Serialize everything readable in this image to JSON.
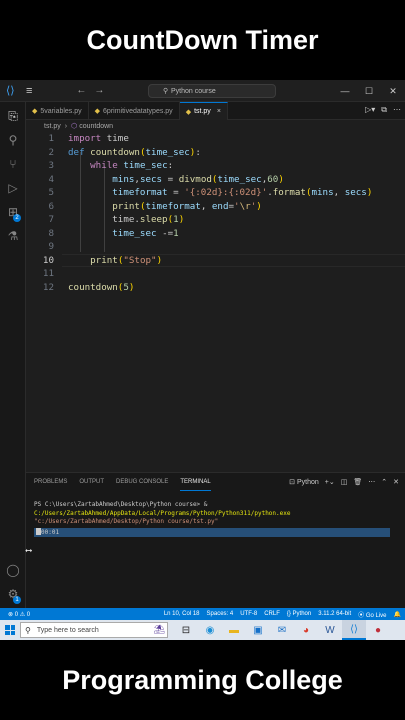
{
  "banner_top": "CountDown Timer",
  "banner_bottom": "Programming College",
  "titlebar": {
    "search_text": "Python course",
    "window_controls": [
      "—",
      "☐",
      "✕"
    ]
  },
  "tabs": [
    {
      "label": "5variables.py",
      "active": false
    },
    {
      "label": "6primitivedatatypes.py",
      "active": false
    },
    {
      "label": "tst.py",
      "active": true
    }
  ],
  "breadcrumb": {
    "file": "tst.py",
    "symbol": "countdown"
  },
  "editor": {
    "current_line": 10,
    "line_numbers": [
      "1",
      "2",
      "3",
      "4",
      "5",
      "6",
      "7",
      "8",
      "9",
      "10",
      "11",
      "12"
    ]
  },
  "panel": {
    "tabs": [
      "PROBLEMS",
      "OUTPUT",
      "DEBUG CONSOLE",
      "TERMINAL"
    ],
    "active_tab": "TERMINAL",
    "shell_label": "Python",
    "terminal": {
      "prompt": "PS C:\\Users\\ZartabAhmed\\Desktop\\Python course> & ",
      "exe_path": "C:/Users/ZartabAhmed/AppData/Local/Programs/Python/Python311/python.exe",
      "script_arg": "\"c:/Users/ZartabAhmed/Desktop/Python course/tst.py\"",
      "output": "00:01"
    }
  },
  "statusbar": {
    "problems": "⊗ 0 ⚠ 0",
    "position": "Ln 10, Col 18",
    "spaces": "Spaces: 4",
    "encoding": "UTF-8",
    "eol": "CRLF",
    "language": "{} Python",
    "interpreter": "3.11.2 64-bit",
    "golive": "⦿ Go Live"
  },
  "taskbar": {
    "search_placeholder": "Type here to search"
  },
  "colors": {
    "accent": "#0078d4",
    "editor_bg": "#1e1e1e",
    "keyword": "#c586c0",
    "function": "#dcdcaa",
    "string": "#ce9178",
    "number": "#b5cea8"
  }
}
